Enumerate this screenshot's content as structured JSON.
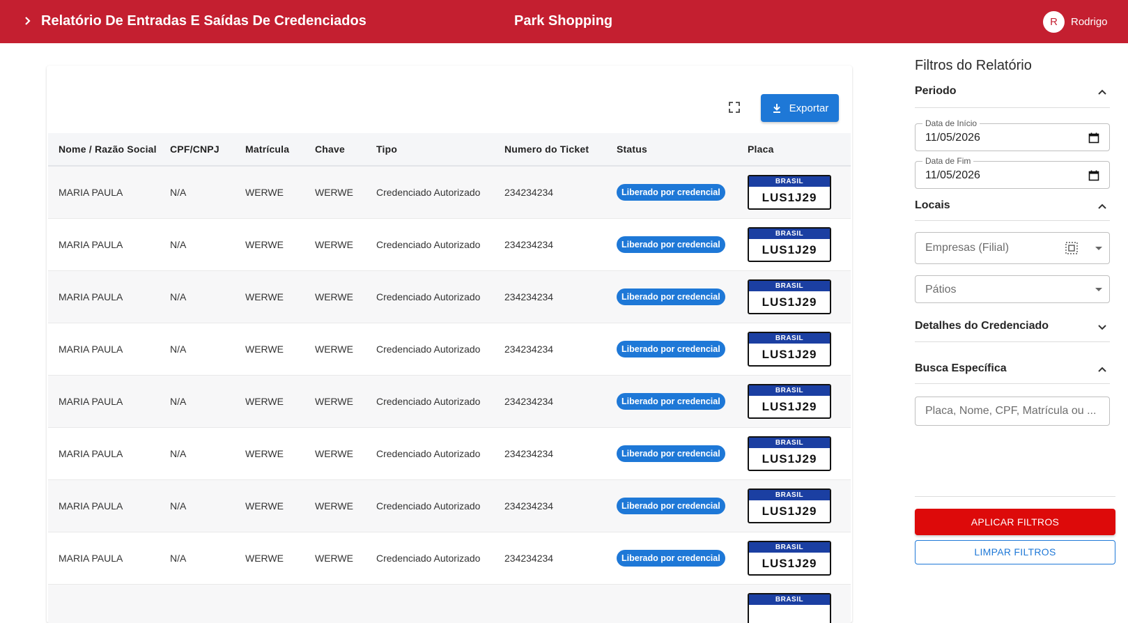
{
  "header": {
    "title": "Relatório De Entradas E Saídas De Credenciados",
    "center_title": "Park Shopping",
    "user_initial": "R",
    "user_name": "Rodrigo",
    "bg_color": "#c41f30"
  },
  "toolbar": {
    "export_label": "Exportar",
    "fullscreen_icon": "fullscreen-icon",
    "export_icon": "download-icon"
  },
  "table": {
    "columns": [
      "Nome / Razão Social",
      "CPF/CNPJ",
      "Matrícula",
      "Chave",
      "Tipo",
      "Numero do Ticket",
      "Status",
      "Placa"
    ],
    "rows": [
      {
        "nome": "MARIA PAULA",
        "cpf": "N/A",
        "matricula": "WERWE",
        "chave": "WERWE",
        "tipo": "Credenciado Autorizado",
        "ticket": "234234234",
        "status": "Liberado por credencial",
        "plate_country": "BRASIL",
        "plate": "LUS1J29"
      },
      {
        "nome": "MARIA PAULA",
        "cpf": "N/A",
        "matricula": "WERWE",
        "chave": "WERWE",
        "tipo": "Credenciado Autorizado",
        "ticket": "234234234",
        "status": "Liberado por credencial",
        "plate_country": "BRASIL",
        "plate": "LUS1J29"
      },
      {
        "nome": "MARIA PAULA",
        "cpf": "N/A",
        "matricula": "WERWE",
        "chave": "WERWE",
        "tipo": "Credenciado Autorizado",
        "ticket": "234234234",
        "status": "Liberado por credencial",
        "plate_country": "BRASIL",
        "plate": "LUS1J29"
      },
      {
        "nome": "MARIA PAULA",
        "cpf": "N/A",
        "matricula": "WERWE",
        "chave": "WERWE",
        "tipo": "Credenciado Autorizado",
        "ticket": "234234234",
        "status": "Liberado por credencial",
        "plate_country": "BRASIL",
        "plate": "LUS1J29"
      },
      {
        "nome": "MARIA PAULA",
        "cpf": "N/A",
        "matricula": "WERWE",
        "chave": "WERWE",
        "tipo": "Credenciado Autorizado",
        "ticket": "234234234",
        "status": "Liberado por credencial",
        "plate_country": "BRASIL",
        "plate": "LUS1J29"
      },
      {
        "nome": "MARIA PAULA",
        "cpf": "N/A",
        "matricula": "WERWE",
        "chave": "WERWE",
        "tipo": "Credenciado Autorizado",
        "ticket": "234234234",
        "status": "Liberado por credencial",
        "plate_country": "BRASIL",
        "plate": "LUS1J29"
      },
      {
        "nome": "MARIA PAULA",
        "cpf": "N/A",
        "matricula": "WERWE",
        "chave": "WERWE",
        "tipo": "Credenciado Autorizado",
        "ticket": "234234234",
        "status": "Liberado por credencial",
        "plate_country": "BRASIL",
        "plate": "LUS1J29"
      },
      {
        "nome": "MARIA PAULA",
        "cpf": "N/A",
        "matricula": "WERWE",
        "chave": "WERWE",
        "tipo": "Credenciado Autorizado",
        "ticket": "234234234",
        "status": "Liberado por credencial",
        "plate_country": "BRASIL",
        "plate": "LUS1J29"
      },
      {
        "nome": "",
        "cpf": "",
        "matricula": "",
        "chave": "",
        "tipo": "",
        "ticket": "",
        "status": "",
        "plate_country": "BRASIL",
        "plate": ""
      }
    ]
  },
  "sidebar": {
    "title": "Filtros do Relatório",
    "periodo": {
      "label": "Periodo",
      "start_label": "Data de Início",
      "start_value": "11/05/2026",
      "end_label": "Data de Fim",
      "end_value": "11/05/2026"
    },
    "locais": {
      "label": "Locais",
      "empresas_placeholder": "Empresas (Filial)",
      "patios_placeholder": "Pátios"
    },
    "detalhes": {
      "label": "Detalhes do Credenciado"
    },
    "busca": {
      "label": "Busca Específica",
      "placeholder": "Placa, Nome, CPF, Matrícula ou ..."
    },
    "apply_label": "APLICAR FILTROS",
    "clear_label": "LIMPAR FILTROS"
  }
}
